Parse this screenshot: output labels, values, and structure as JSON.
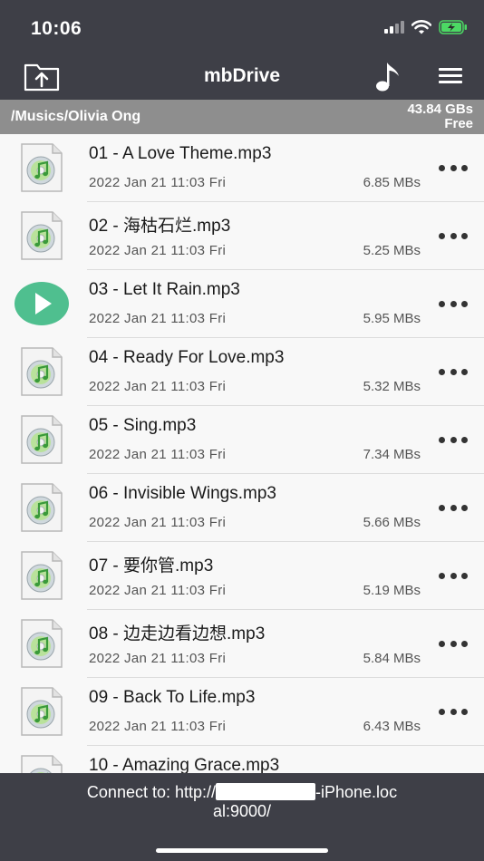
{
  "status_bar": {
    "time": "10:06"
  },
  "header": {
    "title": "mbDrive"
  },
  "pathbar": {
    "path": "/Musics/Olivia Ong",
    "free_amount": "43.84 GBs",
    "free_label": "Free"
  },
  "files": [
    {
      "name": "01 - A Love Theme.mp3",
      "date": "2022 Jan 21  11:03 Fri",
      "size": "6.85 MBs",
      "playing": false
    },
    {
      "name": "02 - 海枯石烂.mp3",
      "date": "2022 Jan 21  11:03 Fri",
      "size": "5.25 MBs",
      "playing": false
    },
    {
      "name": "03 - Let It Rain.mp3",
      "date": "2022 Jan 21  11:03 Fri",
      "size": "5.95 MBs",
      "playing": true
    },
    {
      "name": "04 - Ready For Love.mp3",
      "date": "2022 Jan 21  11:03 Fri",
      "size": "5.32 MBs",
      "playing": false
    },
    {
      "name": "05 - Sing.mp3",
      "date": "2022 Jan 21  11:03 Fri",
      "size": "7.34 MBs",
      "playing": false
    },
    {
      "name": "06 - Invisible Wings.mp3",
      "date": "2022 Jan 21  11:03 Fri",
      "size": "5.66 MBs",
      "playing": false
    },
    {
      "name": "07 - 要你管.mp3",
      "date": "2022 Jan 21  11:03 Fri",
      "size": "5.19 MBs",
      "playing": false
    },
    {
      "name": "08 - 边走边看边想.mp3",
      "date": "2022 Jan 21  11:03 Fri",
      "size": "5.84 MBs",
      "playing": false
    },
    {
      "name": "09 - Back To Life.mp3",
      "date": "2022 Jan 21  11:03 Fri",
      "size": "6.43 MBs",
      "playing": false
    },
    {
      "name": "10 - Amazing Grace.mp3",
      "date": "",
      "size": "",
      "playing": false
    }
  ],
  "footer": {
    "connect_prefix": "Connect to: http://",
    "connect_suffix": "-iPhone.loc",
    "connect_line2": "al:9000/"
  },
  "colors": {
    "bar": "#3e3f47",
    "pathbar": "#8e8e8e",
    "play": "#4fbf8f",
    "battery": "#4cd964"
  }
}
